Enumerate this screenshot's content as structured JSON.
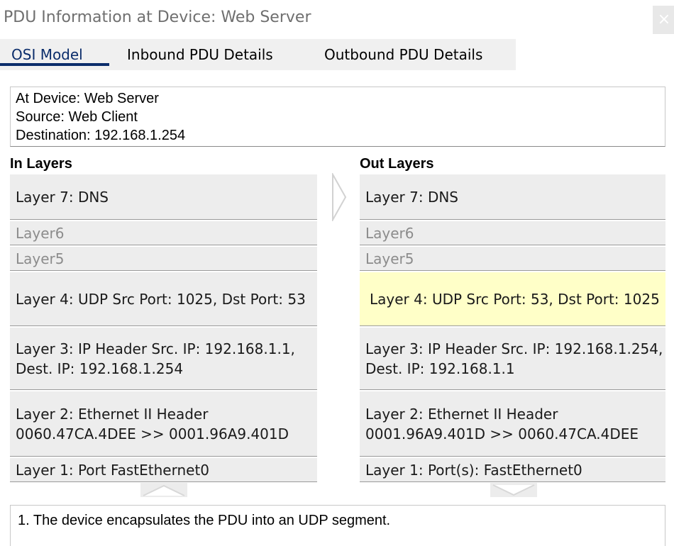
{
  "window": {
    "title": "PDU Information at Device: Web Server",
    "close_label": "×"
  },
  "tabs": [
    {
      "label": "OSI Model",
      "active": true
    },
    {
      "label": "Inbound PDU Details",
      "active": false
    },
    {
      "label": "Outbound PDU Details",
      "active": false
    }
  ],
  "info": {
    "device": "At Device: Web Server",
    "source": "Source: Web Client",
    "destination": "Destination: 192.168.1.254"
  },
  "in_layers": {
    "title": "In Layers",
    "items": [
      {
        "text": "Layer 7: DNS",
        "dim": false
      },
      {
        "text": "Layer6",
        "dim": true
      },
      {
        "text": "Layer5",
        "dim": true
      },
      {
        "text": "Layer 4: UDP Src Port: 1025, Dst Port: 53",
        "dim": false
      },
      {
        "text": "Layer 3: IP Header Src. IP: 192.168.1.1, Dest. IP: 192.168.1.254",
        "dim": false
      },
      {
        "text": "Layer 2: Ethernet II Header 0060.47CA.4DEE >> 0001.96A9.401D",
        "dim": false
      },
      {
        "text": "Layer 1: Port FastEthernet0",
        "dim": false
      }
    ]
  },
  "out_layers": {
    "title": "Out Layers",
    "items": [
      {
        "text": "Layer 7: DNS",
        "dim": false
      },
      {
        "text": "Layer6",
        "dim": true
      },
      {
        "text": "Layer5",
        "dim": true
      },
      {
        "text": "Layer 4: UDP Src Port: 53, Dst Port: 1025",
        "dim": false,
        "highlighted": true
      },
      {
        "text": "Layer 3: IP Header Src. IP: 192.168.1.254, Dest. IP: 192.168.1.1",
        "dim": false
      },
      {
        "text": "Layer 2: Ethernet II Header 0001.96A9.401D >> 0060.47CA.4DEE",
        "dim": false
      },
      {
        "text": "Layer 1: Port(s): FastEthernet0",
        "dim": false
      }
    ]
  },
  "description": {
    "text": "1. The device encapsulates the PDU into an UDP segment."
  },
  "colors": {
    "active_tab": "#0b2d6b",
    "layer_bg": "#ededed",
    "highlight": "#ffffc8"
  },
  "icons": {
    "close": "close-icon",
    "direction": "chevron-right-icon",
    "prev": "chevron-up-icon",
    "next": "chevron-down-icon"
  }
}
